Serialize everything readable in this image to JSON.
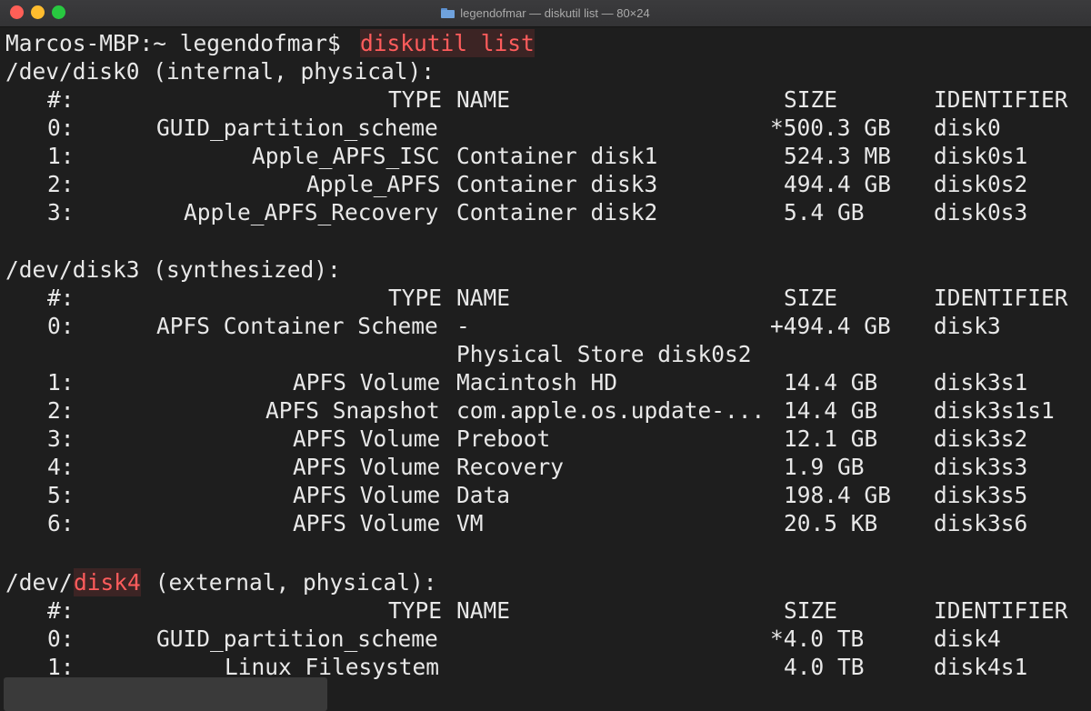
{
  "window": {
    "title": "legendofmar — diskutil list — 80×24"
  },
  "prompt": {
    "text": "Marcos-MBP:~ legendofmar$ ",
    "command": "diskutil list"
  },
  "headers": {
    "num": "#:",
    "type": "TYPE",
    "name": "NAME",
    "size": "SIZE",
    "identifier": "IDENTIFIER"
  },
  "disks": [
    {
      "title": "/dev/disk0 (internal, physical):",
      "rows": [
        {
          "num": "0:",
          "type": "GUID_partition_scheme",
          "name": "",
          "size": "*500.3 GB",
          "identifier": "disk0"
        },
        {
          "num": "1:",
          "type": "Apple_APFS_ISC",
          "name": "Container disk1",
          "size": "524.3 MB",
          "identifier": "disk0s1"
        },
        {
          "num": "2:",
          "type": "Apple_APFS",
          "name": "Container disk3",
          "size": "494.4 GB",
          "identifier": "disk0s2"
        },
        {
          "num": "3:",
          "type": "Apple_APFS_Recovery",
          "name": "Container disk2",
          "size": "5.4 GB",
          "identifier": "disk0s3"
        }
      ]
    },
    {
      "title": "/dev/disk3 (synthesized):",
      "rows": [
        {
          "num": "0:",
          "type": "APFS Container Scheme",
          "name": "-",
          "size": "+494.4 GB",
          "identifier": "disk3",
          "continuation": "Physical Store disk0s2"
        },
        {
          "num": "1:",
          "type": "APFS Volume",
          "name": "Macintosh HD",
          "size": "14.4 GB",
          "identifier": "disk3s1"
        },
        {
          "num": "2:",
          "type": "APFS Snapshot",
          "name": "com.apple.os.update-...",
          "size": "14.4 GB",
          "identifier": "disk3s1s1"
        },
        {
          "num": "3:",
          "type": "APFS Volume",
          "name": "Preboot",
          "size": "12.1 GB",
          "identifier": "disk3s2"
        },
        {
          "num": "4:",
          "type": "APFS Volume",
          "name": "Recovery",
          "size": "1.9 GB",
          "identifier": "disk3s3"
        },
        {
          "num": "5:",
          "type": "APFS Volume",
          "name": "Data",
          "size": "198.4 GB",
          "identifier": "disk3s5"
        },
        {
          "num": "6:",
          "type": "APFS Volume",
          "name": "VM",
          "size": "20.5 KB",
          "identifier": "disk3s6"
        }
      ]
    },
    {
      "title_prefix": "/dev/",
      "title_highlight": "disk4",
      "title_suffix": " (external, physical):",
      "rows": [
        {
          "num": "0:",
          "type": "GUID_partition_scheme",
          "name": "",
          "size": "*4.0 TB",
          "identifier": "disk4"
        },
        {
          "num": "1:",
          "type": "Linux Filesystem",
          "name": "",
          "size": "4.0 TB",
          "identifier": "disk4s1"
        }
      ]
    }
  ],
  "colors": {
    "background": "#1e1e1e",
    "text": "#e8e8e8",
    "highlight": "#ff5c5c"
  }
}
